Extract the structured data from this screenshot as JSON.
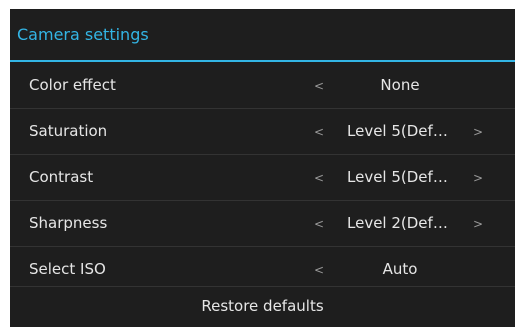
{
  "dialog": {
    "title": "Camera settings"
  },
  "settings": [
    {
      "label": "Color effect",
      "prev": "<",
      "value": "None",
      "next": ""
    },
    {
      "label": "Saturation",
      "prev": "<",
      "value": "Level 5(Def…",
      "next": ">"
    },
    {
      "label": "Contrast",
      "prev": "<",
      "value": "Level 5(Def…",
      "next": ">"
    },
    {
      "label": "Sharpness",
      "prev": "<",
      "value": "Level 2(Def…",
      "next": ">"
    },
    {
      "label": "Select ISO",
      "prev": "<",
      "value": "Auto",
      "next": ""
    }
  ],
  "footer": {
    "restore_label": "Restore defaults"
  },
  "colors": {
    "accent": "#33b5e5",
    "background": "#1e1e1e",
    "text": "#e6e6e6",
    "divider": "#333333"
  }
}
